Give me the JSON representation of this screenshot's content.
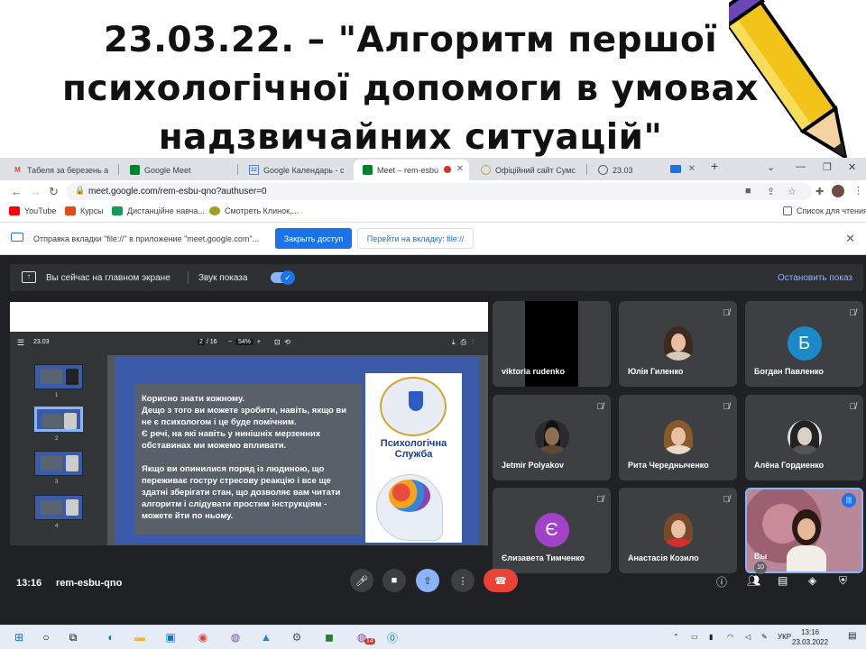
{
  "slide": {
    "title": "23.03.22. – \"Алгоритм першої психологічної допомоги в умовах надзвичайних ситуацій\""
  },
  "browser": {
    "tabs": [
      {
        "label": "Табеля за березень а",
        "icon": "gmail-icon",
        "color": "#ea4335"
      },
      {
        "label": "Google Meet",
        "icon": "meet-icon",
        "color": "#00832d"
      },
      {
        "label": "Google Календарь - с",
        "icon": "calendar-icon",
        "color": "#4285f4"
      },
      {
        "label": "Meet – rem-esbu",
        "icon": "meet-icon",
        "color": "#00832d"
      },
      {
        "label": "Офіційний сайт Сумс",
        "icon": "site-icon",
        "color": "#d4a530"
      },
      {
        "label": "23.03",
        "icon": "globe-icon",
        "color": "#5f6368"
      }
    ],
    "url": "meet.google.com/rem-esbu-qno?authuser=0",
    "bookmarks": [
      "YouTube",
      "Курсы",
      "Дистанційне навча...",
      "Смотреть Клинок,..."
    ],
    "reading_list": "Список для чтения",
    "infobar": {
      "message": "Отправка вкладки \"file://\" в приложение \"meet.google.com\"...",
      "close_access": "Закрыть доступ",
      "go_to_tab": "Перейти на вкладку: file://"
    }
  },
  "meet": {
    "presenting_text": "Вы сейчас на главном экране",
    "sound_text": "Звук показа",
    "stop_text": "Остановить показ",
    "pdf": {
      "name": "23.03",
      "page": "2",
      "page_total": "/ 16",
      "zoom": "54%",
      "thumb_numbers": [
        "1",
        "2",
        "3",
        "4"
      ]
    },
    "slide_text": {
      "p1": "Корисно знати кожному.\nДещо з того ви можете зробити, навіть, якщо ви не є психологом і це буде помічним.\nЄ речі, на які навіть у нинішніх мерзенних обставинах ми можемо впливати.",
      "p2": "Якщо ви опинилися поряд із людиною, що переживає гостру стресову реакцію і все ще здатні зберігати стан, що дозволяє вам читати алгоритм і слідувати простим інструкціям - можете йти по ньому.",
      "logo_label": "Психологічна Служба"
    },
    "participants": [
      {
        "name": "viktoria rudenko",
        "type": "video"
      },
      {
        "name": "Юлія Гиленко",
        "type": "photo"
      },
      {
        "name": "Богдан Павленко",
        "type": "letter",
        "letter": "Б",
        "color": "#1a8ac9"
      },
      {
        "name": "Jetmir Polyakov",
        "type": "photo"
      },
      {
        "name": "Рита Чередныченко",
        "type": "photo"
      },
      {
        "name": "Алёна Гордиенко",
        "type": "photo"
      },
      {
        "name": "Єлизавета Тимченко",
        "type": "letter",
        "letter": "Є",
        "color": "#a142c9"
      },
      {
        "name": "Анастасія Козило",
        "type": "photo"
      },
      {
        "name": "Вы",
        "type": "self"
      }
    ],
    "time": "13:16",
    "meeting_code": "rem-esbu-qno",
    "participants_count": "10"
  },
  "taskbar": {
    "lang": "УКР",
    "time": "13:16",
    "date": "23.03.2022",
    "badge": "14"
  }
}
